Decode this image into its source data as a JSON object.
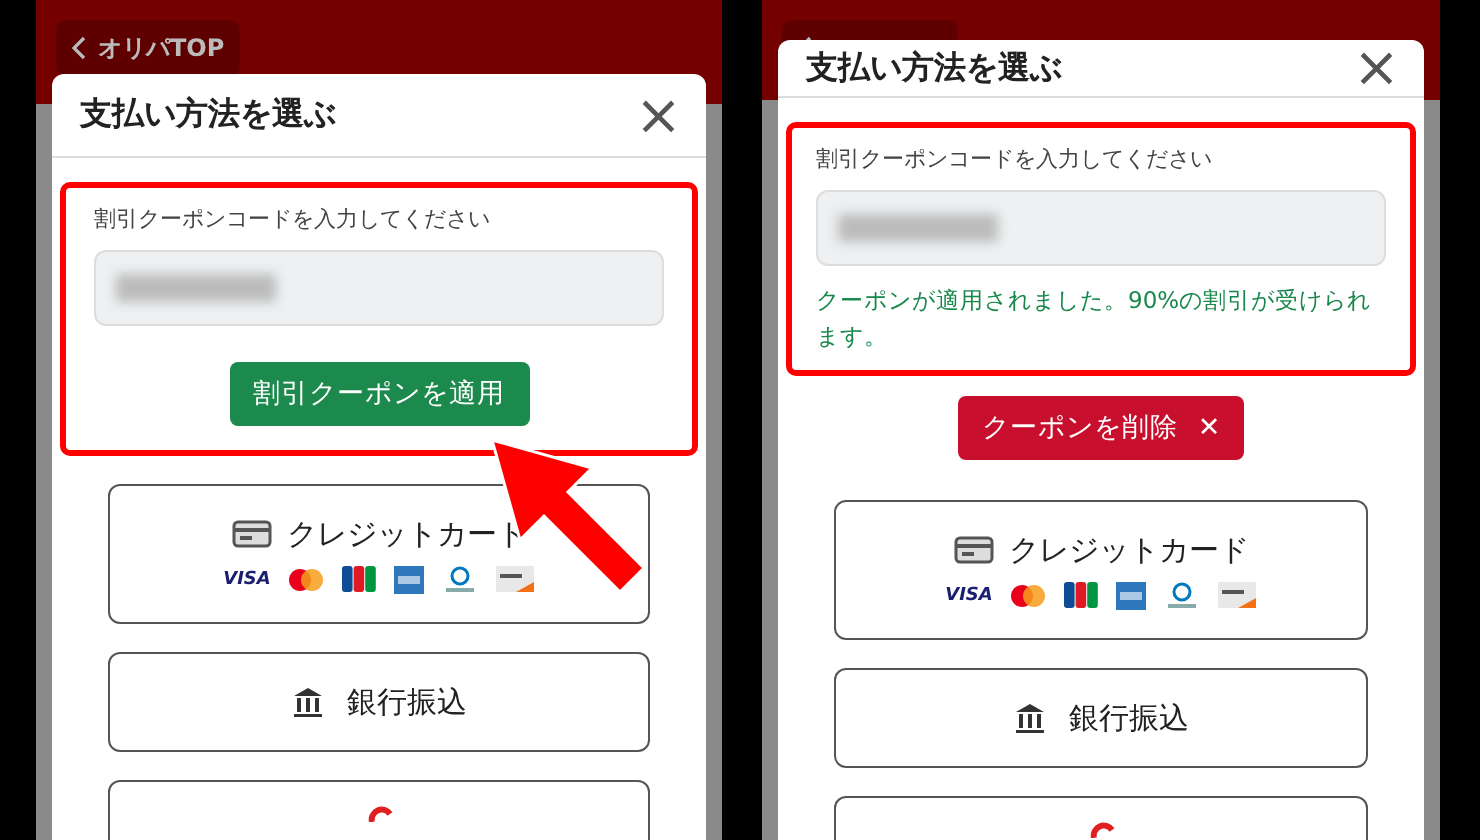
{
  "panels": [
    {
      "back_button": {
        "label": "オリパTOP"
      },
      "modal": {
        "title": "支払い方法を選ぶ",
        "close_glyph": "×"
      },
      "coupon": {
        "highlighted": true,
        "label": "割引クーポンコードを入力してください",
        "value_blurred": true,
        "button": {
          "kind": "apply",
          "label": "割引クーポンを適用"
        }
      },
      "pointer_arrow": true,
      "payment_methods": [
        {
          "kind": "card",
          "label": "クレジットカード",
          "brands": [
            "VISA"
          ]
        },
        {
          "kind": "bank",
          "label": "銀行振込"
        },
        {
          "kind": "cut_off"
        }
      ]
    },
    {
      "modal": {
        "title": "支払い方法を選ぶ",
        "close_glyph": "×"
      },
      "coupon": {
        "highlighted": true,
        "label": "割引クーポンコードを入力してください",
        "value_blurred": true,
        "message": "クーポンが適用されました。90%の割引が受けられます。",
        "button": {
          "kind": "remove",
          "label": "クーポンを削除",
          "glyph": "✕"
        }
      },
      "pointer_arrow": false,
      "payment_methods": [
        {
          "kind": "card",
          "label": "クレジットカード",
          "brands": [
            "VISA"
          ]
        },
        {
          "kind": "bank",
          "label": "銀行振込"
        },
        {
          "kind": "cut_off"
        }
      ]
    }
  ]
}
